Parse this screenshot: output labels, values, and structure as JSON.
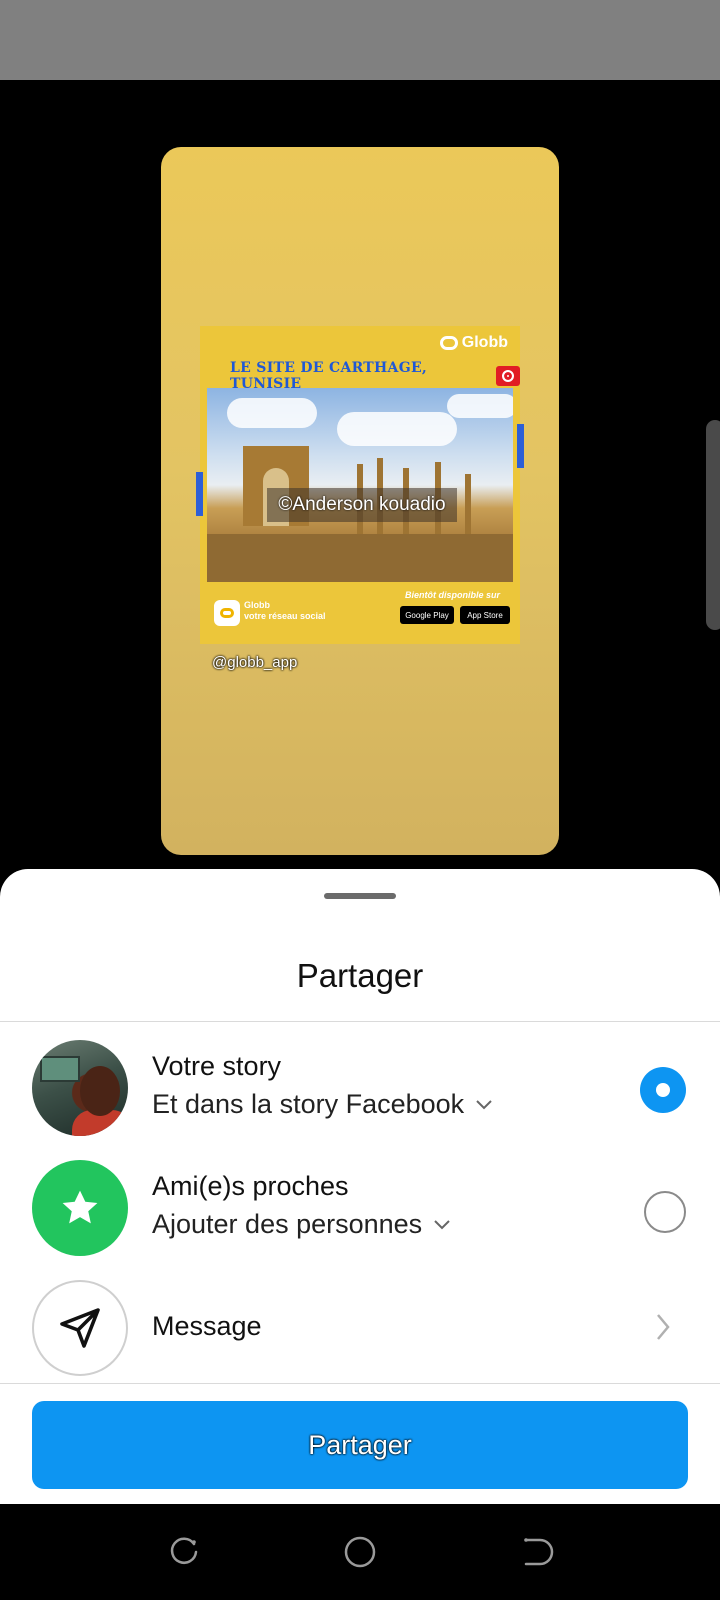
{
  "story_preview": {
    "poster": {
      "brand": "Globb",
      "title": "LE SITE DE CARTHAGE, TUNISIE",
      "photo_credit": "©Anderson kouadio",
      "app_name": "Globb",
      "app_tagline": "votre réseau social",
      "availability": "Bientôt disponible sur",
      "store_google": "Google Play",
      "store_apple": "App Store"
    },
    "handle": "@globb_app"
  },
  "share_sheet": {
    "title": "Partager",
    "options": [
      {
        "title": "Votre story",
        "subtitle": "Et dans la story Facebook",
        "selected": true,
        "icon": "user-avatar"
      },
      {
        "title": "Ami(e)s proches",
        "subtitle": "Ajouter des personnes",
        "selected": false,
        "icon": "star-icon"
      },
      {
        "title": "Message",
        "icon": "send-icon"
      }
    ],
    "button_label": "Partager"
  },
  "colors": {
    "accent": "#0d95f2",
    "close_friends": "#22c55e",
    "story_background": "#e3c463"
  },
  "nav_bar": [
    "recent-apps-icon",
    "home-icon",
    "back-icon"
  ]
}
